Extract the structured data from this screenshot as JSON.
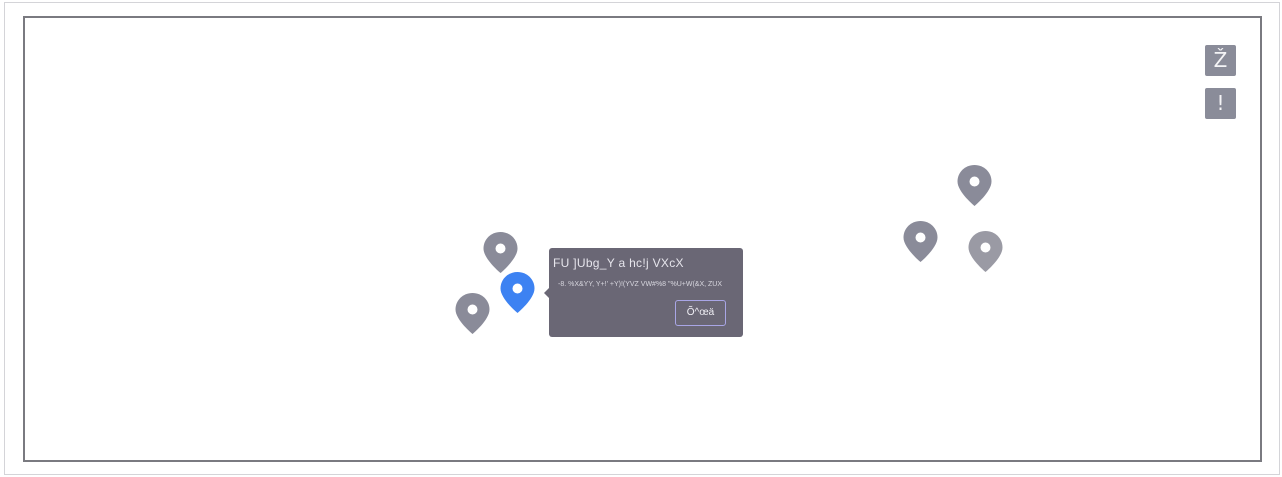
{
  "map": {
    "controls": [
      {
        "glyph": "Ž"
      },
      {
        "glyph": "!"
      }
    ],
    "markers": [
      {
        "id": "marker-1",
        "color": "#8a8b99",
        "icon": "map-pin-icon",
        "selected": false
      },
      {
        "id": "marker-2",
        "color": "#3d82f2",
        "icon": "map-pin-icon",
        "selected": true
      },
      {
        "id": "marker-3",
        "color": "#8a8b99",
        "icon": "map-pin-icon",
        "selected": false
      },
      {
        "id": "marker-4",
        "color": "#8a8b99",
        "icon": "map-pin-icon",
        "selected": false
      },
      {
        "id": "marker-5",
        "color": "#8a8b99",
        "icon": "map-pin-icon",
        "selected": false
      },
      {
        "id": "marker-6",
        "color": "#9a9aa4",
        "icon": "map-pin-icon",
        "selected": false
      }
    ],
    "popup": {
      "title": "FU ]Ubg_Y a  hc!j  VXcX",
      "description": "-8. %X&YY, Y+!' +Y)!(YVZ VW#%8 \"%U+W(&X, ZUX",
      "button_label": "Õ^œä"
    }
  }
}
